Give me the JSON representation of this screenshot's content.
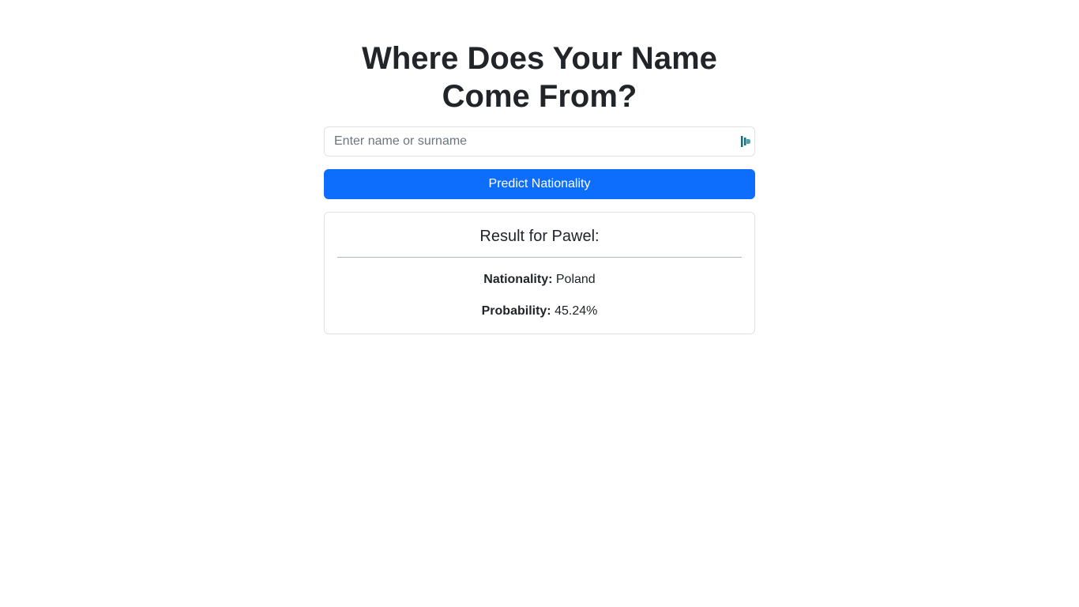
{
  "header": {
    "title": "Where Does Your Name Come From?"
  },
  "form": {
    "input_placeholder": "Enter name or surname",
    "input_value": "",
    "submit_label": "Predict Nationality"
  },
  "result": {
    "title": "Result for Pawel:",
    "nationality_label": "Nationality:",
    "nationality_value": "Poland",
    "probability_label": "Probability:",
    "probability_value": "45.24%"
  },
  "colors": {
    "primary": "#0d6efd",
    "text": "#212529",
    "border": "#dee2e6",
    "extension_icon": "#1a6c7a"
  },
  "icons": {
    "input_extension": "password-manager-icon"
  }
}
